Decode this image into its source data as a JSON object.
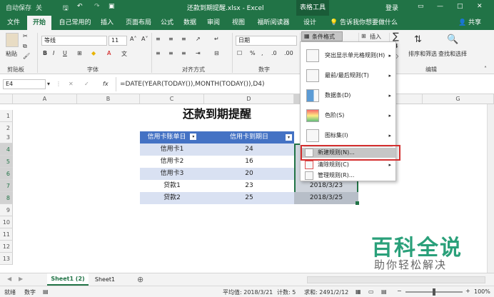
{
  "titlebar": {
    "autosave": "自动保存",
    "toggle": "关",
    "filename": "还款到期提醒.xlsx  -  Excel",
    "context_tab": "表格工具",
    "login": "登录"
  },
  "tabs": [
    "文件",
    "开始",
    "自己常用的",
    "插入",
    "页面布局",
    "公式",
    "数据",
    "审阅",
    "视图",
    "福昕阅读器",
    "设计"
  ],
  "tell_me": "告诉我你想要做什么",
  "share": "共享",
  "ribbon": {
    "paste": "粘贴",
    "clipboard": "剪贴板",
    "font_name": "等线",
    "font_size": "11",
    "font_group": "字体",
    "align_group": "对齐方式",
    "number_format": "日期",
    "number_group": "数字",
    "cf_button": "条件格式",
    "insert": "插入",
    "sort_filter": "排序和筛选",
    "find_select": "查找和选择",
    "edit_group": "编辑",
    "sum_symbol": "∑"
  },
  "formula": {
    "namebox": "E4",
    "fx": "fx",
    "text": "=DATE(YEAR(TODAY()),MONTH(TODAY()),D4)"
  },
  "columns": [
    "A",
    "B",
    "C",
    "D",
    "E",
    "F",
    "G"
  ],
  "rows": [
    "1",
    "2",
    "3",
    "4",
    "5",
    "6",
    "7",
    "8",
    "9",
    "10",
    "11",
    "12",
    "13"
  ],
  "sheet_title": "还款到期提醒",
  "table": {
    "headers": [
      "信用卡账单日",
      "信用卡到期日"
    ],
    "rows": [
      {
        "name": "信用卡1",
        "day": "24"
      },
      {
        "name": "信用卡2",
        "day": "16"
      },
      {
        "name": "信用卡3",
        "day": "20"
      },
      {
        "name": "贷款1",
        "day": "23"
      },
      {
        "name": "贷款2",
        "day": "25"
      }
    ],
    "dates": [
      "2018/3/23",
      "2018/3/25"
    ]
  },
  "cf_menu": [
    {
      "label": "突出显示单元格规则(H)",
      "arrow": "▸"
    },
    {
      "label": "最前/最后规则(T)",
      "arrow": "▸"
    },
    {
      "label": "数据条(D)",
      "arrow": "▸"
    },
    {
      "label": "色阶(S)",
      "arrow": "▸"
    },
    {
      "label": "图标集(I)",
      "arrow": "▸"
    },
    {
      "label": "新建规则(N)...",
      "arrow": ""
    },
    {
      "label": "清除规则(C)",
      "arrow": "▸"
    },
    {
      "label": "管理规则(R)...",
      "arrow": ""
    }
  ],
  "sheets": [
    "Sheet1 (2)",
    "Sheet1"
  ],
  "add_sheet": "⊕",
  "status": {
    "ready": "就绪",
    "mode": "数字",
    "average": "平均值: 2018/3/21",
    "count": "计数: 5",
    "sum": "求和: 2491/2/12",
    "zoom": "100%"
  },
  "watermark": {
    "main": "百科全说",
    "sub": "助你轻松解决"
  },
  "colors": {
    "excel_green": "#217346",
    "table_header": "#4472c4",
    "table_band": "#d9e1f2",
    "highlight_red": "#d32f2f"
  }
}
